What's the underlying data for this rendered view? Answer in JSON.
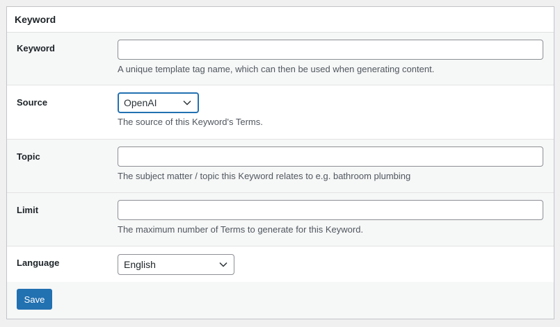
{
  "panel": {
    "title": "Keyword"
  },
  "fields": {
    "keyword": {
      "label": "Keyword",
      "value": "",
      "description": "A unique template tag name, which can then be used when generating content."
    },
    "source": {
      "label": "Source",
      "selected": "OpenAI",
      "description": "The source of this Keyword's Terms."
    },
    "topic": {
      "label": "Topic",
      "value": "",
      "description": "The subject matter / topic this Keyword relates to e.g. bathroom plumbing"
    },
    "limit": {
      "label": "Limit",
      "value": "",
      "description": "The maximum number of Terms to generate for this Keyword."
    },
    "language": {
      "label": "Language",
      "selected": "English"
    }
  },
  "footer": {
    "save_label": "Save"
  },
  "colors": {
    "accent": "#2271b1",
    "background": "#f0f0f1",
    "panel": "#ffffff",
    "row_alt": "#f6f7f7",
    "description_text": "#50575e"
  },
  "icons": {
    "select_arrow": "chevron-down-icon"
  }
}
